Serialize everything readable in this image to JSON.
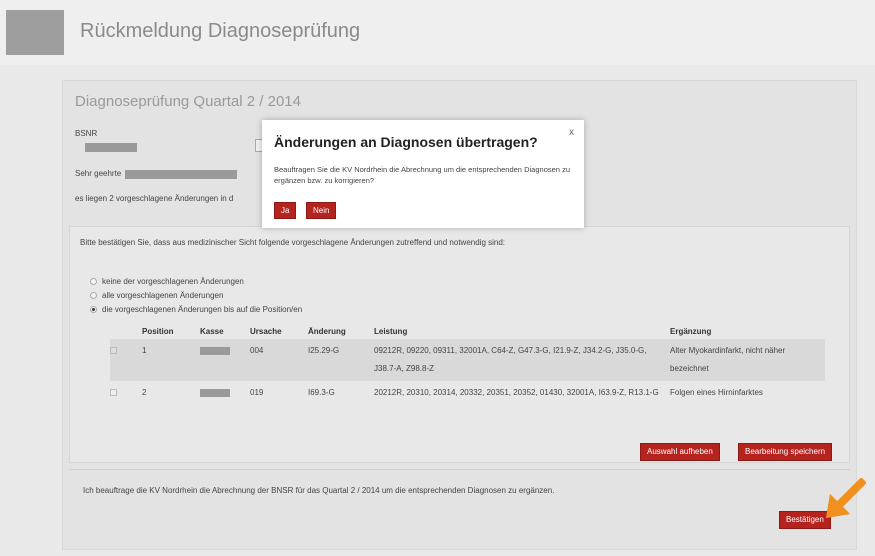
{
  "page": {
    "title": "Rückmeldung Diagnoseprüfung"
  },
  "card": {
    "title": "Diagnoseprüfung Quartal 2 / 2014",
    "bsnr_label": "BSNR",
    "greeting": "Sehr geehrte",
    "pending_text": "es liegen 2 vorgeschlagene Änderungen in d",
    "confirm_text": "Bitte bestätigen Sie, dass aus medizinischer Sicht folgende vorgeschlagene Änderungen zutreffend und notwendig sind:",
    "options": [
      {
        "label": "keine der vorgeschlagenen Änderungen",
        "checked": false
      },
      {
        "label": "alle vorgeschlagenen Änderungen",
        "checked": false
      },
      {
        "label": "die vorgeschlagenen Änderungen bis auf die Position/en",
        "checked": true
      }
    ],
    "table": {
      "headers": [
        "Position",
        "Kasse",
        "Ursache",
        "Änderung",
        "Leistung",
        "Ergänzung"
      ],
      "rows": [
        {
          "checked": true,
          "position": "1",
          "ursache": "004",
          "aenderung": "I25.29-G",
          "leistung": "09212R, 09220, 09311, 32001A, C64-Z, G47.3-G, I21.9-Z, J34.2-G, J35.0-G, J38.7-A, Z98.8-Z",
          "ergaenzung": "Alter Myokardinfarkt, nicht näher bezeichnet"
        },
        {
          "checked": false,
          "position": "2",
          "ursache": "019",
          "aenderung": "I69.3-G",
          "leistung": "20212R, 20310, 20314, 20332, 20351, 20352, 01430, 32001A, I63.9-Z, R13.1-G",
          "ergaenzung": "Folgen eines Hirninfarktes"
        }
      ]
    },
    "btn_deselect": "Auswahl aufheben",
    "btn_save": "Bearbeitung speichern",
    "commission_text": "Ich beauftrage die KV Nordrhein die Abrechnung der BNSR für das Quartal 2 / 2014 um die entsprechenden Diagnosen zu ergänzen.",
    "btn_confirm": "Bestätigen"
  },
  "modal": {
    "title": "Änderungen an Diagnosen übertragen?",
    "close": "x",
    "text": "Beauftragen Sie die KV Nordrhein die Abrechnung um die entsprechenden Diagnosen zu ergänzen bzw. zu korrigieren?",
    "yes": "Ja",
    "no": "Nein"
  },
  "colors": {
    "accent": "#b5231f",
    "arrow": "#f0901e"
  }
}
